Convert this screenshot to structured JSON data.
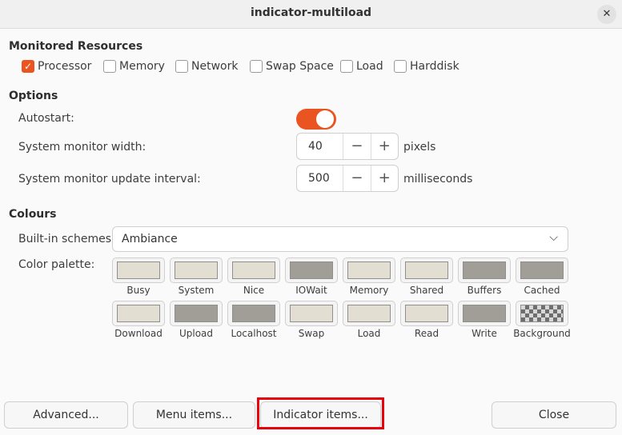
{
  "window": {
    "title": "indicator-multiload",
    "close_glyph": "✕"
  },
  "monitored": {
    "title": "Monitored Resources",
    "items": [
      {
        "label": "Processor",
        "checked": true
      },
      {
        "label": "Memory",
        "checked": false
      },
      {
        "label": "Network",
        "checked": false
      },
      {
        "label": "Swap Space",
        "checked": false
      },
      {
        "label": "Load",
        "checked": false
      },
      {
        "label": "Harddisk",
        "checked": false
      }
    ]
  },
  "options": {
    "title": "Options",
    "autostart_label": "Autostart:",
    "autostart_on": true,
    "width_label": "System monitor width:",
    "width_value": "40",
    "width_unit": "pixels",
    "interval_label": "System monitor update interval:",
    "interval_value": "500",
    "interval_unit": "milliseconds",
    "minus": "−",
    "plus": "+"
  },
  "colours": {
    "title": "Colours",
    "schemes_label": "Built-in schemes:",
    "scheme_value": "Ambiance",
    "palette_label": "Color palette:",
    "swatches": [
      {
        "label": "Busy",
        "color": "#e2ded2"
      },
      {
        "label": "System",
        "color": "#e2ded2"
      },
      {
        "label": "Nice",
        "color": "#e2ded2"
      },
      {
        "label": "IOWait",
        "color": "#a19e97"
      },
      {
        "label": "Memory",
        "color": "#e2ded2"
      },
      {
        "label": "Shared",
        "color": "#e2ded2"
      },
      {
        "label": "Buffers",
        "color": "#a19e97"
      },
      {
        "label": "Cached",
        "color": "#a19e97"
      },
      {
        "label": "Download",
        "color": "#e2ded2"
      },
      {
        "label": "Upload",
        "color": "#a19e97"
      },
      {
        "label": "Localhost",
        "color": "#a19e97"
      },
      {
        "label": "Swap",
        "color": "#e2ded2"
      },
      {
        "label": "Load",
        "color": "#e2ded2"
      },
      {
        "label": "Read",
        "color": "#e2ded2"
      },
      {
        "label": "Write",
        "color": "#a19e97"
      },
      {
        "label": "Background",
        "color": "checker"
      }
    ]
  },
  "buttons": {
    "advanced": "Advanced...",
    "menu_items": "Menu items...",
    "indicator_items": "Indicator items...",
    "close": "Close"
  },
  "accent_color": "#e95420",
  "highlight_color": "#e8000b"
}
